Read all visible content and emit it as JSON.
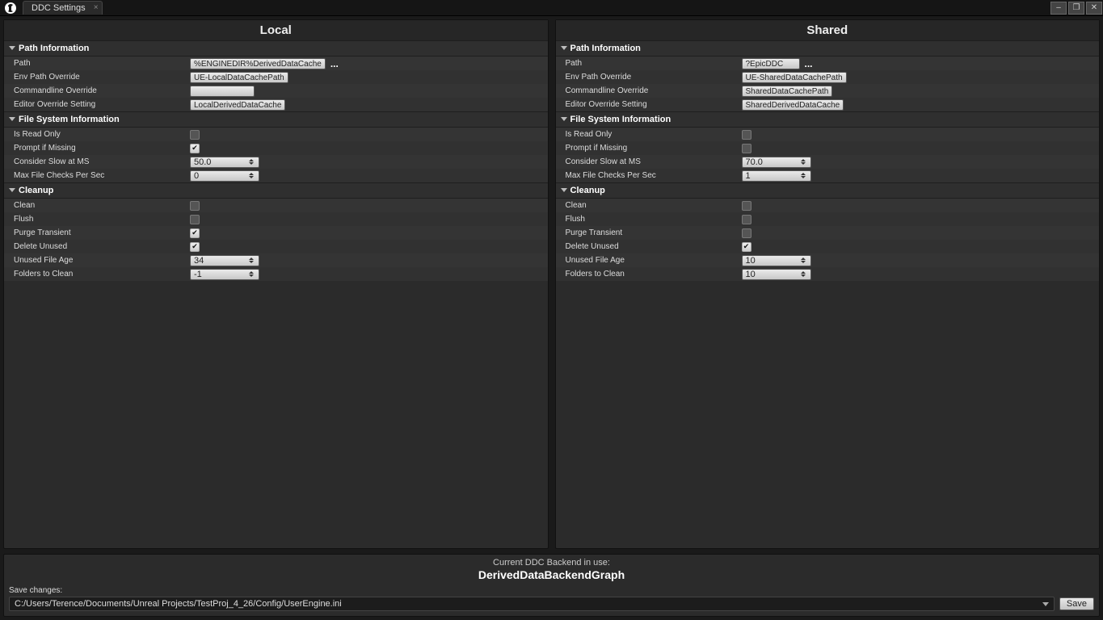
{
  "window": {
    "tab_title": "DDC Settings"
  },
  "panels": {
    "local": {
      "title": "Local",
      "sections": {
        "path": {
          "header": "Path Information",
          "path_label": "Path",
          "path_value": "%ENGINEDIR%DerivedDataCache",
          "env_label": "Env Path Override",
          "env_value": "UE-LocalDataCachePath",
          "cmd_label": "Commandline Override",
          "cmd_value": "",
          "editor_label": "Editor Override Setting",
          "editor_value": "LocalDerivedDataCache"
        },
        "fs": {
          "header": "File System Information",
          "readonly_label": "Is Read Only",
          "readonly_checked": false,
          "prompt_label": "Prompt if Missing",
          "prompt_checked": true,
          "slow_label": "Consider Slow at MS",
          "slow_value": "50.0",
          "max_label": "Max File Checks Per Sec",
          "max_value": "0"
        },
        "cleanup": {
          "header": "Cleanup",
          "clean_label": "Clean",
          "clean_checked": false,
          "flush_label": "Flush",
          "flush_checked": false,
          "purge_label": "Purge Transient",
          "purge_checked": true,
          "delete_label": "Delete Unused",
          "delete_checked": true,
          "age_label": "Unused File Age",
          "age_value": "34",
          "folders_label": "Folders to Clean",
          "folders_value": "-1"
        }
      }
    },
    "shared": {
      "title": "Shared",
      "sections": {
        "path": {
          "header": "Path Information",
          "path_label": "Path",
          "path_value": "?EpicDDC",
          "env_label": "Env Path Override",
          "env_value": "UE-SharedDataCachePath",
          "cmd_label": "Commandline Override",
          "cmd_value": "SharedDataCachePath",
          "editor_label": "Editor Override Setting",
          "editor_value": "SharedDerivedDataCache"
        },
        "fs": {
          "header": "File System Information",
          "readonly_label": "Is Read Only",
          "readonly_checked": false,
          "prompt_label": "Prompt if Missing",
          "prompt_checked": false,
          "slow_label": "Consider Slow at MS",
          "slow_value": "70.0",
          "max_label": "Max File Checks Per Sec",
          "max_value": "1"
        },
        "cleanup": {
          "header": "Cleanup",
          "clean_label": "Clean",
          "clean_checked": false,
          "flush_label": "Flush",
          "flush_checked": false,
          "purge_label": "Purge Transient",
          "purge_checked": false,
          "delete_label": "Delete Unused",
          "delete_checked": true,
          "age_label": "Unused File Age",
          "age_value": "10",
          "folders_label": "Folders to Clean",
          "folders_value": "10"
        }
      }
    }
  },
  "footer": {
    "info_text": "Current DDC Backend in use:",
    "backend_name": "DerivedDataBackendGraph",
    "save_label": "Save changes:",
    "save_path": "C:/Users/Terence/Documents/Unreal Projects/TestProj_4_26/Config/UserEngine.ini",
    "save_button": "Save"
  }
}
